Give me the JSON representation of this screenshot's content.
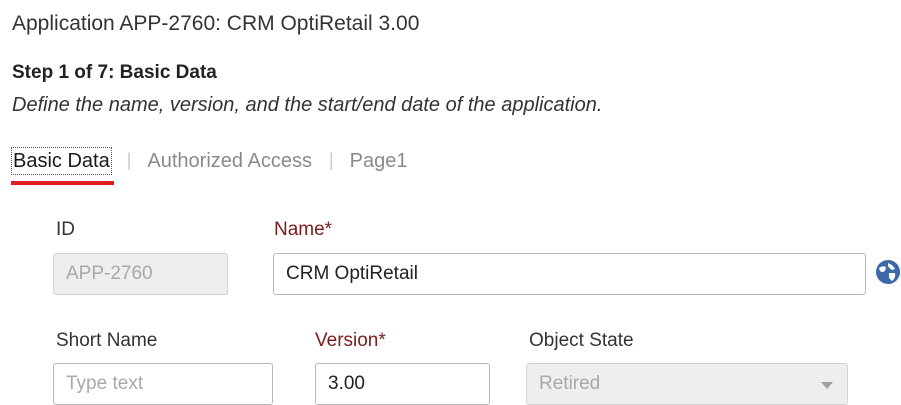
{
  "header": {
    "app_title": "Application APP-2760: CRM OptiRetail 3.00",
    "step_title": "Step 1 of 7: Basic Data",
    "step_description": "Define the name, version, and the start/end date of the application."
  },
  "tabs": [
    {
      "label": "Basic Data",
      "active": true
    },
    {
      "label": "Authorized Access",
      "active": false
    },
    {
      "label": "Page1",
      "active": false
    }
  ],
  "tab_separator": "|",
  "form": {
    "id": {
      "label": "ID",
      "value": "APP-2760",
      "disabled": true
    },
    "name": {
      "label": "Name*",
      "value": "CRM OptiRetail",
      "required": true
    },
    "short_name": {
      "label": "Short Name",
      "value": "",
      "placeholder": "Type text"
    },
    "version": {
      "label": "Version*",
      "value": "3.00",
      "required": true
    },
    "object_state": {
      "label": "Object State",
      "value": "Retired",
      "disabled": true
    }
  },
  "icons": {
    "translate": "globe-translate-icon",
    "dropdown": "chevron-down-icon"
  },
  "colors": {
    "active_tab_underline": "#e01e1e",
    "required_label": "#7a1c1c",
    "translate_icon": "#3b6aa6"
  }
}
